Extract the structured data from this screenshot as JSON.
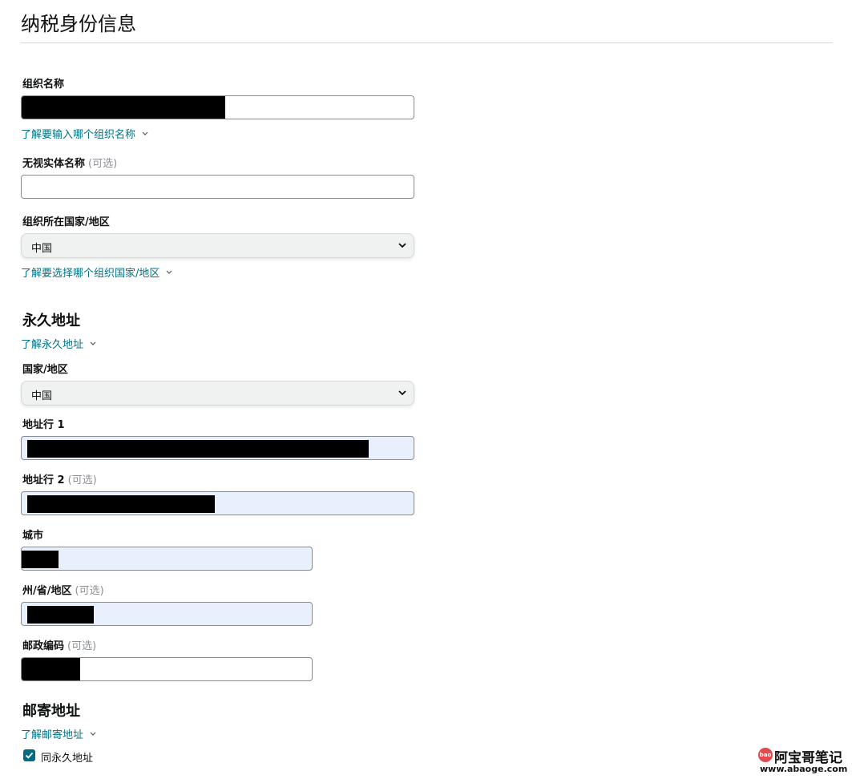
{
  "page": {
    "title": "纳税身份信息"
  },
  "org": {
    "name_label": "组织名称",
    "name_help": "了解要输入哪个组织名称",
    "dba_label": "无视实体名称",
    "dba_optional": "(可选)",
    "country_label": "组织所在国家/地区",
    "country_value": "中国",
    "country_help": "了解要选择哪个组织国家/地区"
  },
  "permanent_address": {
    "heading": "永久地址",
    "help": "了解永久地址",
    "country_label": "国家/地区",
    "country_value": "中国",
    "line1_label": "地址行 1",
    "line2_label": "地址行 2",
    "line2_optional": "(可选)",
    "city_label": "城市",
    "state_label": "州/省/地区",
    "state_optional": "(可选)",
    "zip_label": "邮政编码",
    "zip_optional": "(可选)"
  },
  "mailing_address": {
    "heading": "邮寄地址",
    "help": "了解邮寄地址",
    "same_as_permanent_label": "同永久地址",
    "same_as_permanent_checked": true
  },
  "watermark": {
    "badge": "bao",
    "title": "阿宝哥笔记",
    "url": "www.abaoge.com"
  },
  "colors": {
    "link": "#007185",
    "checkbox": "#016b84",
    "autofill_bg": "#e8f0fe"
  },
  "icons": {
    "select_arrow": "chevron-down-icon",
    "help_caret": "caret-down-icon",
    "checkbox_mark": "check-icon"
  }
}
